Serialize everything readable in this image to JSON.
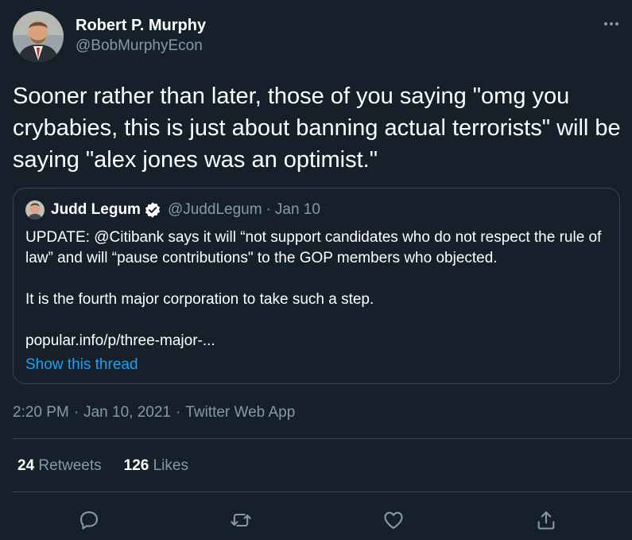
{
  "tweet": {
    "author": {
      "display_name": "Robert P. Murphy",
      "handle": "@BobMurphyEcon",
      "avatar_icon": "person-avatar"
    },
    "more_icon": "more-horizontal-icon",
    "text": "Sooner rather than later, those of you saying \"omg you crybabies, this is just about banning actual terrorists\" will be saying \"alex jones was an optimist.\""
  },
  "quoted_tweet": {
    "display_name": "Judd Legum",
    "verified_icon": "verified-badge-icon",
    "handle": "@JuddLegum",
    "separator": "·",
    "date": "Jan 10",
    "paragraphs": [
      "UPDATE: @Citibank says it will “not support candidates who do not respect the rule of law” and will “pause contributions\" to the GOP members who objected.",
      "It is the fourth major corporation to take such a step.",
      "popular.info/p/three-major-..."
    ],
    "show_thread_label": "Show this thread"
  },
  "meta": {
    "time": "2:20 PM",
    "separator_1": "·",
    "date": "Jan 10, 2021",
    "separator_2": "·",
    "source": "Twitter Web App"
  },
  "stats": {
    "retweets_count": "24",
    "retweets_label": "Retweets",
    "likes_count": "126",
    "likes_label": "Likes"
  },
  "actions": [
    {
      "name": "reply",
      "icon": "reply-icon"
    },
    {
      "name": "retweet",
      "icon": "retweet-icon"
    },
    {
      "name": "like",
      "icon": "heart-icon"
    },
    {
      "name": "share",
      "icon": "share-icon"
    }
  ],
  "colors": {
    "background": "#15202b",
    "text_primary": "#ffffff",
    "text_secondary": "#8899a6",
    "link": "#1da1f2",
    "border": "#38444d"
  }
}
